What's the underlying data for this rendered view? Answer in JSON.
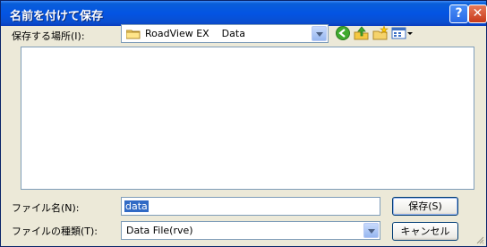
{
  "window": {
    "title": "名前を付けて保存"
  },
  "titlebar_buttons": {
    "help": "?",
    "close": "✕"
  },
  "location": {
    "label": "保存する場所(I):",
    "value": "RoadView EX    Data"
  },
  "toolbar_icons": [
    "back-icon",
    "up-folder-icon",
    "new-folder-icon",
    "view-menu-icon"
  ],
  "filename": {
    "label": "ファイル名(N):",
    "value": "data"
  },
  "filetype": {
    "label": "ファイルの種類(T):",
    "value": "Data File(rve)"
  },
  "buttons": {
    "save": "保存(S)",
    "cancel": "キャンセル"
  }
}
